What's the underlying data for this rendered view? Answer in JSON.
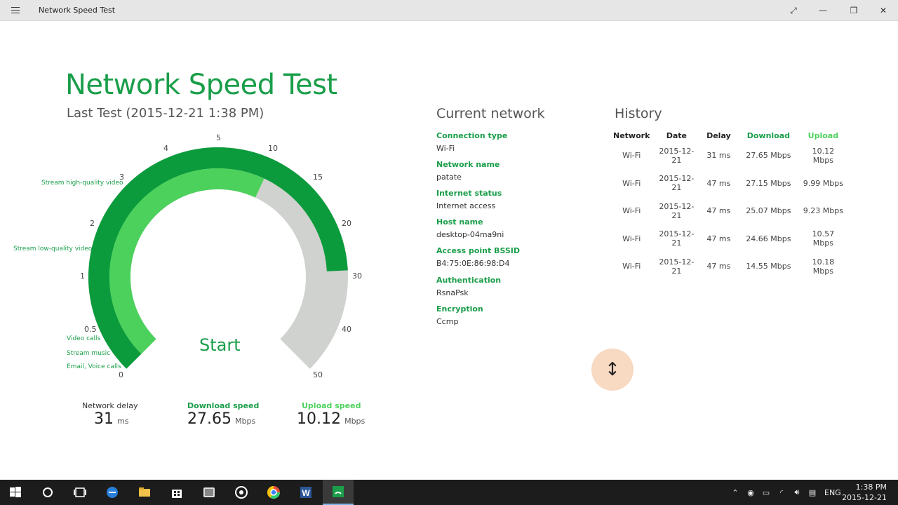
{
  "window": {
    "title": "Network Speed Test"
  },
  "header": {
    "app_title": "Network Speed Test",
    "last_test": "Last Test (2015-12-21 1:38 PM)"
  },
  "gauge": {
    "ticks": [
      "0",
      "0.5",
      "1",
      "2",
      "3",
      "4",
      "5",
      "10",
      "15",
      "20",
      "30",
      "40",
      "50"
    ],
    "use_cases": [
      "Stream high-quality video",
      "Stream low-quality video",
      "Video calls",
      "Stream music",
      "Email, Voice calls"
    ],
    "start_label": "Start",
    "colors": {
      "outer": "#0b9b3c",
      "inner": "#4cd15c",
      "track": "#cfd2ce"
    }
  },
  "stats": {
    "delay": {
      "label": "Network delay",
      "value": "31",
      "unit": "ms"
    },
    "download": {
      "label": "Download speed",
      "value": "27.65",
      "unit": "Mbps"
    },
    "upload": {
      "label": "Upload speed",
      "value": "10.12",
      "unit": "Mbps"
    }
  },
  "current_network": {
    "title": "Current network",
    "items": [
      {
        "key": "Connection type",
        "value": "Wi-Fi"
      },
      {
        "key": "Network name",
        "value": "patate"
      },
      {
        "key": "Internet status",
        "value": "Internet access"
      },
      {
        "key": "Host name",
        "value": "desktop-04ma9ni"
      },
      {
        "key": "Access point BSSID",
        "value": "B4:75:0E:86:98:D4"
      },
      {
        "key": "Authentication",
        "value": "RsnaPsk"
      },
      {
        "key": "Encryption",
        "value": "Ccmp"
      }
    ]
  },
  "history": {
    "title": "History",
    "columns": [
      "Network",
      "Date",
      "Delay",
      "Download",
      "Upload"
    ],
    "rows": [
      [
        "Wi-Fi",
        "2015-12-21",
        "31 ms",
        "27.65 Mbps",
        "10.12 Mbps"
      ],
      [
        "Wi-Fi",
        "2015-12-21",
        "47 ms",
        "27.15 Mbps",
        "9.99 Mbps"
      ],
      [
        "Wi-Fi",
        "2015-12-21",
        "47 ms",
        "25.07 Mbps",
        "9.23 Mbps"
      ],
      [
        "Wi-Fi",
        "2015-12-21",
        "47 ms",
        "24.66 Mbps",
        "10.57 Mbps"
      ],
      [
        "Wi-Fi",
        "2015-12-21",
        "47 ms",
        "14.55 Mbps",
        "10.18 Mbps"
      ]
    ]
  },
  "taskbar": {
    "language": "ENG",
    "time": "1:38 PM",
    "date": "2015-12-21"
  },
  "colors": {
    "accent": "#1a9e4a",
    "accent_light": "#4cd15c"
  }
}
